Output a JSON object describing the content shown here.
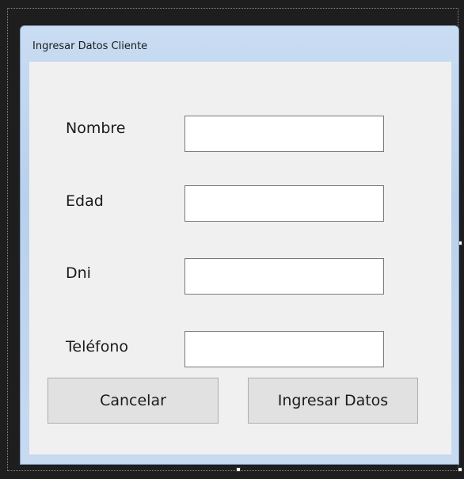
{
  "window": {
    "title": "Ingresar Datos Cliente"
  },
  "form": {
    "fields": [
      {
        "label": "Nombre",
        "value": ""
      },
      {
        "label": "Edad",
        "value": ""
      },
      {
        "label": "Dni",
        "value": ""
      },
      {
        "label": "Teléfono",
        "value": ""
      }
    ]
  },
  "buttons": {
    "cancel_label": "Cancelar",
    "submit_label": "Ingresar Datos"
  }
}
